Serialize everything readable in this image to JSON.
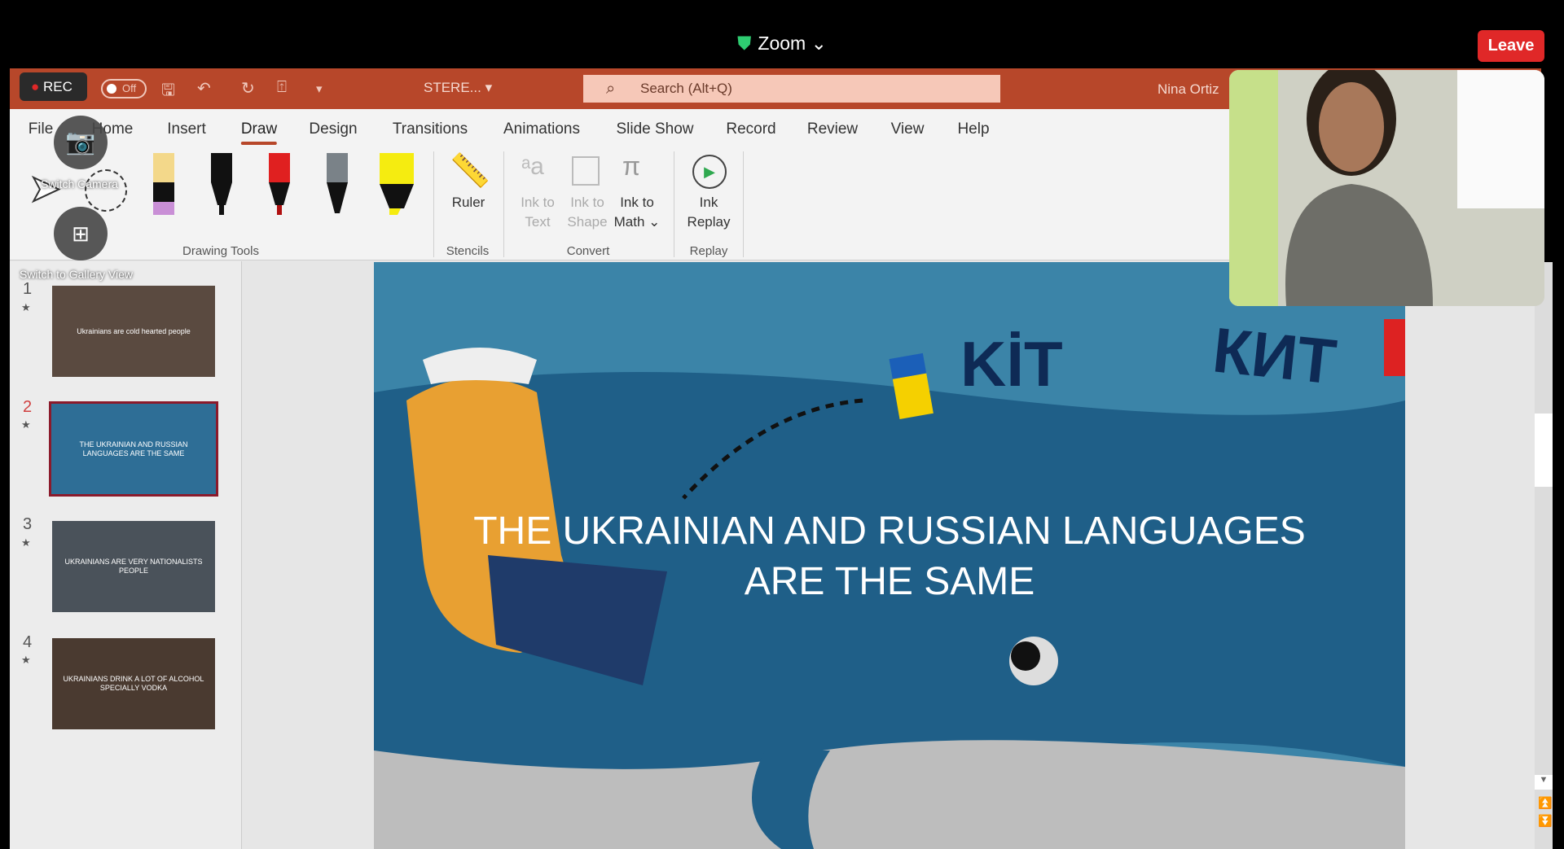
{
  "zoom": {
    "title": "Zoom",
    "leave_label": "Leave"
  },
  "titlebar": {
    "rec_label": "REC",
    "autosave": "Off",
    "filename": "STERE...",
    "search_placeholder": "Search (Alt+Q)",
    "user": "Nina Ortiz"
  },
  "tabs": [
    "File",
    "Home",
    "Insert",
    "Draw",
    "Design",
    "Transitions",
    "Animations",
    "Slide Show",
    "Record",
    "Review",
    "View",
    "Help"
  ],
  "active_tab": "Draw",
  "ribbon": {
    "groups": {
      "drawing_tools": "Drawing Tools",
      "stencils": "Stencils",
      "convert": "Convert",
      "replay": "Replay"
    },
    "ruler": "Ruler",
    "ink_to_text": [
      "Ink to",
      "Text"
    ],
    "ink_to_shape": [
      "Ink to",
      "Shape"
    ],
    "ink_to_math": [
      "Ink to",
      "Math ⌄"
    ],
    "ink_replay": [
      "Ink",
      "Replay"
    ],
    "pen_colors": [
      "#f3d88a",
      "#111111",
      "#e02020",
      "#7a8288",
      "#f5ec10"
    ]
  },
  "overlay": {
    "switch_camera": "Switch Camera",
    "gallery_view": "Switch to Gallery View"
  },
  "slides": [
    {
      "num": "1",
      "text": "Ukrainians are cold hearted people",
      "bg": "#5a4a40"
    },
    {
      "num": "2",
      "text": "THE UKRAINIAN AND RUSSIAN LANGUAGES ARE THE SAME",
      "bg": "#2e6e96"
    },
    {
      "num": "3",
      "text": "UKRAINIANS ARE VERY NATIONALISTS PEOPLE",
      "bg": "#4a525a"
    },
    {
      "num": "4",
      "text": "UKRAINIANS DRINK A LOT OF ALCOHOL SPECIALLY VODKA",
      "bg": "#4a3a30"
    }
  ],
  "current_slide": {
    "title_line1": "THE UKRAINIAN AND RUSSIAN LANGUAGES",
    "title_line2": "ARE THE SAME",
    "word_ua": "KİT",
    "word_ru": "КИТ"
  }
}
